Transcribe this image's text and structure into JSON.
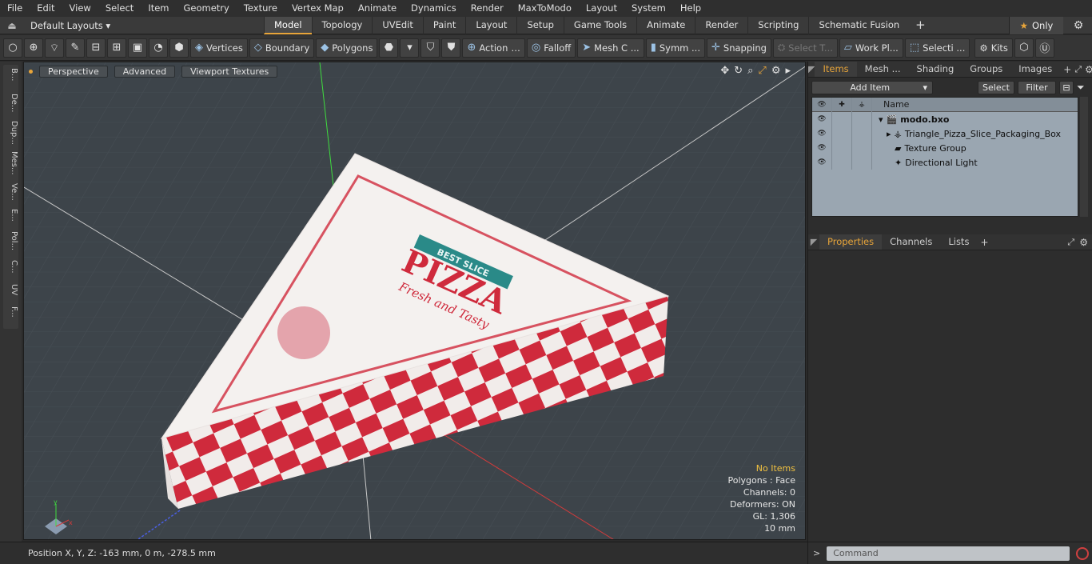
{
  "menu": [
    "File",
    "Edit",
    "View",
    "Select",
    "Item",
    "Geometry",
    "Texture",
    "Vertex Map",
    "Animate",
    "Dynamics",
    "Render",
    "MaxToModo",
    "Layout",
    "System",
    "Help"
  ],
  "layout_bar": {
    "layouts_label": "Default Layouts ▾",
    "tabs": [
      "Model",
      "Topology",
      "UVEdit",
      "Paint",
      "Layout",
      "Setup",
      "Game Tools",
      "Animate",
      "Render",
      "Scripting",
      "Schematic Fusion"
    ],
    "active_tab": "Model",
    "only_label": "Only"
  },
  "toolbar": {
    "vertices": "Vertices",
    "boundary": "Boundary",
    "polygons": "Polygons",
    "action": "Action",
    "falloff": "Falloff",
    "mesh_c": "Mesh C ...",
    "symm": "Symm ...",
    "snapping": "Snapping",
    "select_t": "Select T...",
    "work_pl": "Work Pl...",
    "selecti": "Selecti ...",
    "kits": "Kits"
  },
  "sidebar_tabs": [
    "B...",
    "De...",
    "Dup...",
    "Mes...",
    "Ve...",
    "E...",
    "Pol...",
    "C...",
    "UV",
    "F..."
  ],
  "viewport": {
    "perspective": "Perspective",
    "advanced": "Advanced",
    "textures": "Viewport Textures",
    "info": {
      "no_items": "No Items",
      "polygons": "Polygons : Face",
      "channels": "Channels: 0",
      "deformers": "Deformers: ON",
      "gl": "GL: 1,306",
      "scale": "10 mm"
    },
    "box_texts": {
      "brand": "PIZZA",
      "tagline": "Fresh and Tasty",
      "banner": "BEST SLICE"
    }
  },
  "status": {
    "position": "Position X, Y, Z:   -163 mm, 0 m, -278.5 mm"
  },
  "items_panel": {
    "tabs": [
      "Items",
      "Mesh ...",
      "Shading",
      "Groups",
      "Images"
    ],
    "add_item": "Add Item",
    "select": "Select",
    "filter": "Filter",
    "column_name": "Name",
    "rows": [
      {
        "name": "modo.bxo",
        "bold": true,
        "indent": 0
      },
      {
        "name": "Triangle_Pizza_Slice_Packaging_Box",
        "bold": false,
        "indent": 1
      },
      {
        "name": "Texture Group",
        "bold": false,
        "indent": 1
      },
      {
        "name": "Directional Light",
        "bold": false,
        "indent": 1
      }
    ]
  },
  "properties_panel": {
    "tabs": [
      "Properties",
      "Channels",
      "Lists"
    ]
  },
  "command": {
    "placeholder": "Command"
  },
  "colors": {
    "accent": "#e8a53a",
    "pizza_red": "#cf2a3c",
    "viewport_bg": "#3d444a"
  }
}
